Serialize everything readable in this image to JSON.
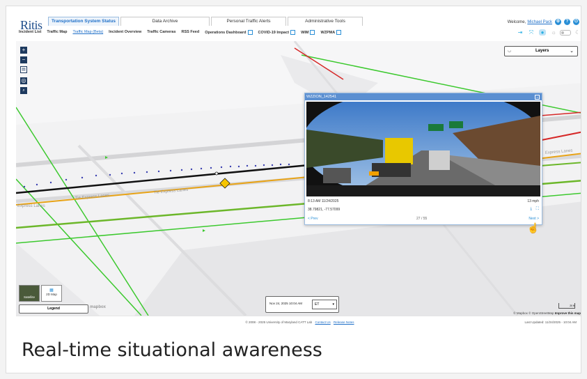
{
  "app": {
    "logo": "Ritis",
    "tabs": [
      {
        "label": "Transportation System Status",
        "active": true
      },
      {
        "label": "Data Archive",
        "active": false
      },
      {
        "label": "Personal Traffic Alerts",
        "active": false
      },
      {
        "label": "Administrative Tools",
        "active": false
      }
    ],
    "subnav": [
      {
        "label": "Incident List",
        "link": false,
        "external": false
      },
      {
        "label": "Traffic Map",
        "link": false,
        "external": false
      },
      {
        "label": "Traffic Map (Beta)",
        "link": true,
        "external": false
      },
      {
        "label": "Incident Overview",
        "link": false,
        "external": false
      },
      {
        "label": "Traffic Cameras",
        "link": false,
        "external": false
      },
      {
        "label": "RSS Feed",
        "link": false,
        "external": false
      },
      {
        "label": "Operations Dashboard",
        "link": false,
        "external": true
      },
      {
        "label": "COVID-19 Impact",
        "link": false,
        "external": true
      },
      {
        "label": "WIM",
        "link": false,
        "external": true
      },
      {
        "label": "WZPMA",
        "link": false,
        "external": true
      }
    ],
    "welcome_text": "Welcome,",
    "user_name": "Michael Pack"
  },
  "map": {
    "layers_label": "Layers",
    "road_labels": [
      "Tie Express Lanes",
      "Tie Express Lanes",
      "Express Lanes",
      "Express Lanes"
    ],
    "satellite_label": "Satellite",
    "map2d_label": "2D Map",
    "legend_label": "Legend",
    "mapbox_label": "mapbox",
    "date_text": "Nov 24, 2025 10:04 AM",
    "timezone": "ET",
    "scale_label": "20 ft",
    "attribution": "© Mapbox © OpenStreetMap",
    "improve_label": "Improve this map"
  },
  "camera": {
    "title": "WZZION_142541",
    "timestamp": "8:13 AM 11/24/2025",
    "speed": "13 mph",
    "coords": "38.79821, -77.57099",
    "prev_label": "< Prev",
    "counter": "27 / 55",
    "next_label": "Next >"
  },
  "footer": {
    "copyright": "© 2008 - 2025 University of Maryland CATT Lab",
    "contact_label": "Contact Us",
    "release_label": "Release Notes",
    "last_updated": "Last Updated: 11/24/2025 - 10:04 AM"
  },
  "caption": "Real-time situational awareness",
  "colors": {
    "accent": "#1e6fc8",
    "popup_header": "#5b8fd1",
    "road_green": "#3cc92e",
    "road_orange": "#e8a316",
    "road_red": "#d62828",
    "dots": "#3a3fb0"
  }
}
